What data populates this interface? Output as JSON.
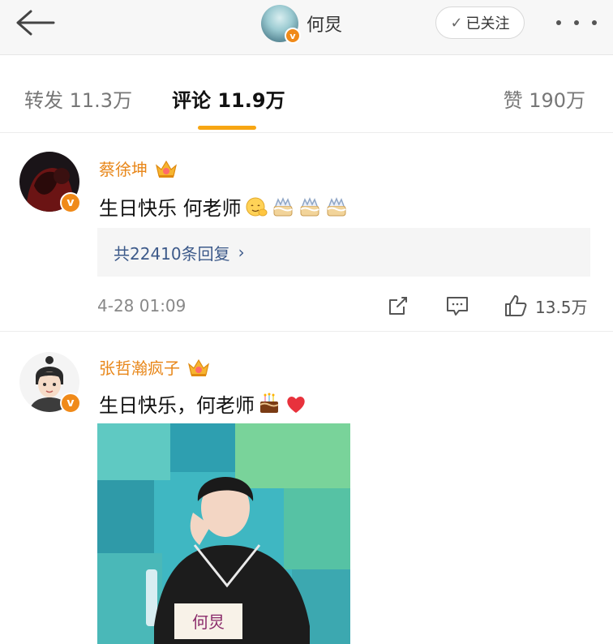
{
  "header": {
    "title": "何炅",
    "follow_label": "已关注",
    "follow_check": "✓"
  },
  "tabs": {
    "repost": "转发 11.3万",
    "comment": "评论 11.9万",
    "like": "赞 190万"
  },
  "comments": [
    {
      "username": "蔡徐坤",
      "text": "生日快乐 何老师",
      "emojis": [
        "hug-emoji",
        "cake-emoji",
        "cake-emoji",
        "cake-emoji"
      ],
      "replies_label": "共22410条回复",
      "replies_chevron": "›",
      "time": "4-28 01:09",
      "likes": "13.5万"
    },
    {
      "username": "张哲瀚疯子",
      "text": "生日快乐，何老师",
      "emojis": [
        "cake-emoji",
        "heart-emoji"
      ],
      "image_label": "何炅"
    }
  ],
  "badge_letter": "v",
  "colors": {
    "accent": "#f7a613",
    "username": "#e8871a",
    "link": "#3d5a8a",
    "vip_badge": "#f08a19"
  }
}
